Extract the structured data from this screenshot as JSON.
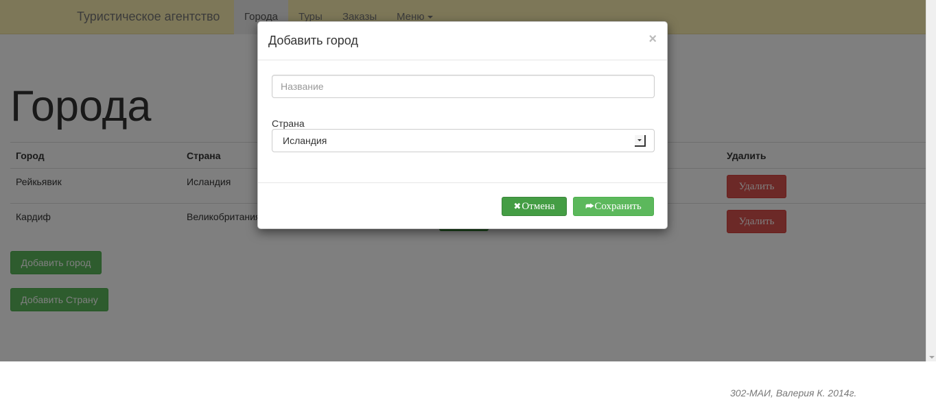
{
  "navbar": {
    "brand": "Туристическое агентство",
    "items": [
      {
        "label": "Города"
      },
      {
        "label": "Туры"
      },
      {
        "label": "Заказы"
      },
      {
        "label": "Меню"
      }
    ]
  },
  "page": {
    "title": "Города",
    "table": {
      "headers": {
        "city": "Город",
        "country": "Страна",
        "delete": "Удалить"
      },
      "rows": [
        {
          "city": "Рейкьявик",
          "country": "Исландия",
          "delete_label": "Удалить"
        },
        {
          "city": "Кардиф",
          "country": "Великобритания",
          "delete_label": "Удалить"
        }
      ]
    },
    "add_city_label": "Добавить город",
    "add_country_label": "Добавить Страну"
  },
  "modal": {
    "title": "Добавить город",
    "close_glyph": "×",
    "name_placeholder": "Название",
    "country_label": "Страна",
    "country_selected": "Исландия",
    "cancel_icon": "✖",
    "cancel_label": "Отмена",
    "save_icon": "⮫",
    "save_label": "Сохранить"
  },
  "footer": {
    "text": "302-МАИ, Валерия К. 2014г."
  }
}
